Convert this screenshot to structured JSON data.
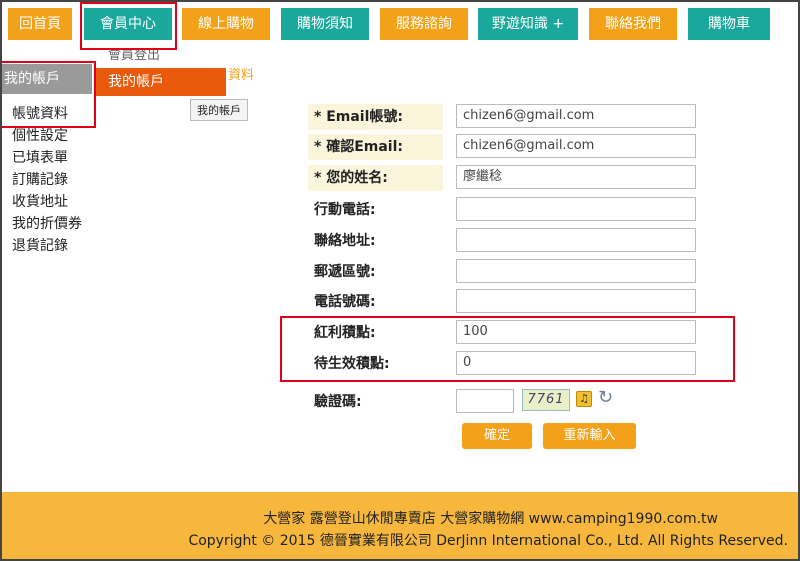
{
  "nav": {
    "items": [
      {
        "label": "回首頁"
      },
      {
        "label": "會員中心"
      },
      {
        "label": "線上購物"
      },
      {
        "label": "購物須知"
      },
      {
        "label": "服務諮詢"
      },
      {
        "label": "野遊知識 +"
      },
      {
        "label": "聯絡我們"
      },
      {
        "label": "購物車"
      }
    ]
  },
  "dropdown": {
    "logout": "會員登出",
    "account": "我的帳戶"
  },
  "sidebar": {
    "header": "我的帳戶",
    "items": [
      {
        "label": "帳號資料"
      },
      {
        "label": "個性設定"
      },
      {
        "label": "已填表單"
      },
      {
        "label": "訂購記錄"
      },
      {
        "label": "收貨地址"
      },
      {
        "label": "我的折價券"
      },
      {
        "label": "退貨記錄"
      }
    ]
  },
  "breadcrumb": "資料",
  "tooltip": "我的帳戶",
  "form": {
    "email_label": "* Email帳號:",
    "email_value": "chizen6@gmail.com",
    "confirm_label": "* 確認Email:",
    "confirm_value": "chizen6@gmail.com",
    "name_label": "* 您的姓名:",
    "name_value": "廖繼稔",
    "mobile_label": "行動電話:",
    "address_label": "聯絡地址:",
    "zip_label": "郵遞區號:",
    "phone_label": "電話號碼:",
    "bonus_label": "紅利積點:",
    "bonus_value": "100",
    "pending_label": "待生效積點:",
    "pending_value": "0",
    "captcha_label": "驗證碼:",
    "captcha_text": "7761"
  },
  "buttons": {
    "confirm": "確定",
    "reset": "重新輸入"
  },
  "footer": {
    "line1": "大營家 露營登山休閒專賣店 大營家購物網 www.camping1990.com.tw",
    "line2": "Copyright © 2015 德晉實業有限公司 DerJinn International Co., Ltd. All Rights Reserved."
  },
  "colors": {
    "orange": "#f4a11a",
    "teal": "#1aa79c",
    "highlight_red": "#e0001a"
  }
}
